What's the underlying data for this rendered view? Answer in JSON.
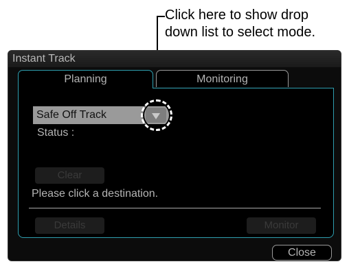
{
  "annotation": {
    "line1": "Click here to show drop",
    "line2": "down list to select mode."
  },
  "dialog": {
    "title": "Instant Track",
    "tabs": [
      {
        "label": "Planning",
        "active": true
      },
      {
        "label": "Monitoring",
        "active": false
      }
    ],
    "mode": {
      "selected": "Safe Off Track",
      "button_icon": "triangle-down-icon"
    },
    "status_label": "Status :",
    "clear_label": "Clear",
    "message": "Please click a destination.",
    "details_label": "Details",
    "monitor_label": "Monitor",
    "close_label": "Close"
  },
  "colors": {
    "accent": "#2e9fb0",
    "background": "#0c0c0c",
    "text": "#b5b5b5",
    "select_bg": "#9a9a9a"
  }
}
